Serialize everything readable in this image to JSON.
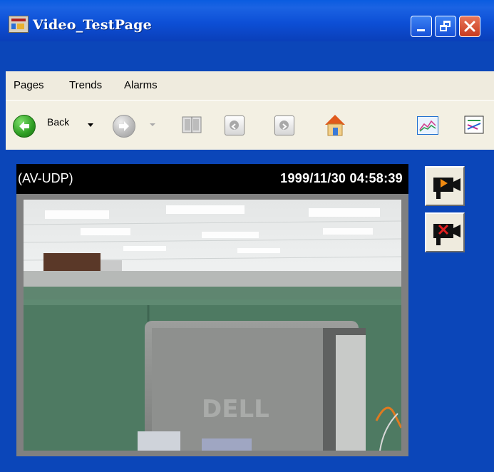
{
  "window": {
    "title": "Video_TestPage"
  },
  "menu": {
    "items": [
      "Pages",
      "Trends",
      "Alarms"
    ]
  },
  "toolbar": {
    "back_label": "Back"
  },
  "video": {
    "protocol_label": "(AV-UDP)",
    "timestamp": "1999/11/30 04:58:39",
    "monitor_brand": "DELL"
  },
  "colors": {
    "desktop_blue": "#0b46b9",
    "menu_bg": "#efebde",
    "title_gradient_top": "#0a5ce0",
    "close_red": "#d9532f"
  },
  "icons": {
    "app": "app-window-icon",
    "back": "back-arrow-icon",
    "forward": "forward-arrow-icon",
    "page": "book-icon",
    "prev": "prev-page-icon",
    "next": "next-page-icon",
    "home": "home-icon",
    "trend": "trend-chart-icon",
    "trend_config": "trend-config-icon",
    "cam_play": "camera-play-icon",
    "cam_stop": "camera-stop-icon"
  }
}
